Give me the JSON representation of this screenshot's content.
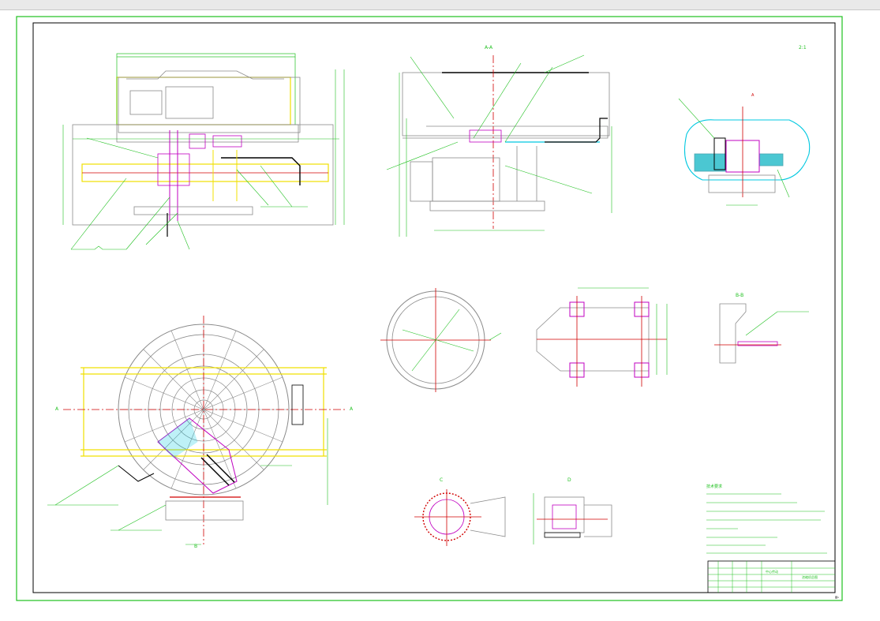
{
  "views": {
    "section_a": "A-A",
    "section_b": "B-B",
    "section_c": "C",
    "section_d": "D",
    "view_a": "A",
    "view_b": "B"
  },
  "labels": {
    "detail_scale": "2:1",
    "fig_number": "图1"
  },
  "title_block": {
    "drawing_title": "中心传动",
    "drawing_name": "浓缩机总图"
  },
  "tech_notes": {
    "heading": "技术要求"
  },
  "colors": {
    "frame": "#1fc01f",
    "border": "#000000",
    "structure": "#8a8a8a",
    "dimension": "#00c000",
    "centerline": "#d00000",
    "piping": "#c000c0",
    "highlight": "#f0e000",
    "water": "#00c8e0",
    "detail": "#00a0c0"
  }
}
